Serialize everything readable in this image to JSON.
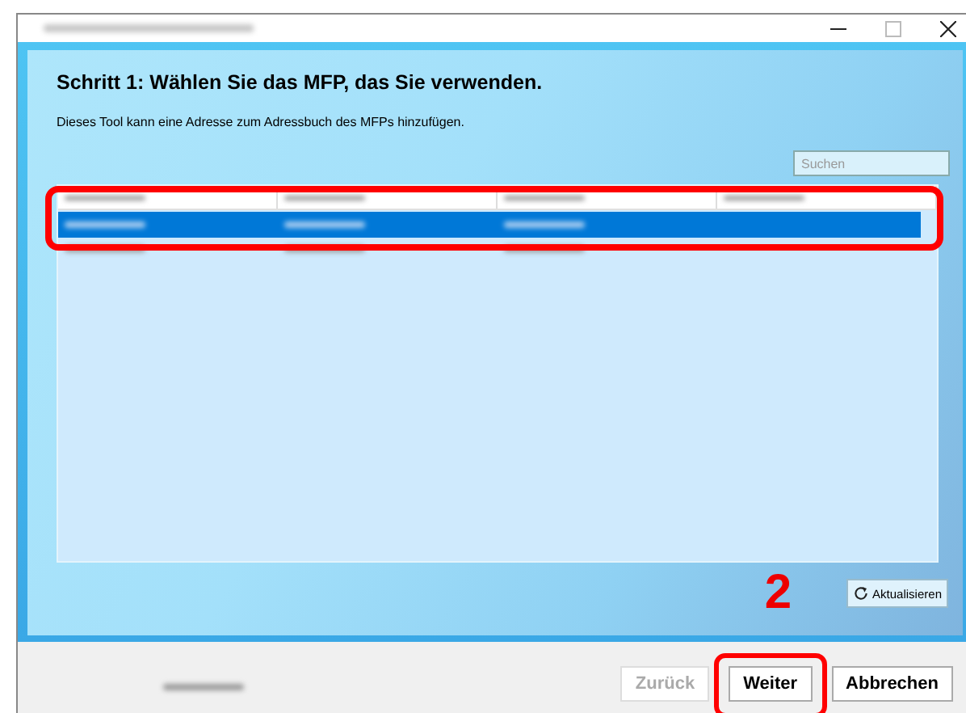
{
  "heading": "Schritt 1: Wählen Sie das MFP, das Sie verwenden.",
  "description": "Dieses Tool kann eine Adresse zum Adressbuch des MFPs hinzufügen.",
  "search": {
    "placeholder": "Suchen"
  },
  "device_list": {
    "rows": [
      {
        "selected": true
      },
      {
        "selected": false
      }
    ]
  },
  "refresh_button": {
    "label": "Aktualisieren"
  },
  "step_marker": "2",
  "buttons": [
    {
      "label": "Zurück",
      "disabled": true,
      "highlighted": false
    },
    {
      "label": "Weiter",
      "disabled": false,
      "highlighted": true
    },
    {
      "label": "Abbrechen",
      "disabled": false,
      "highlighted": false
    }
  ]
}
